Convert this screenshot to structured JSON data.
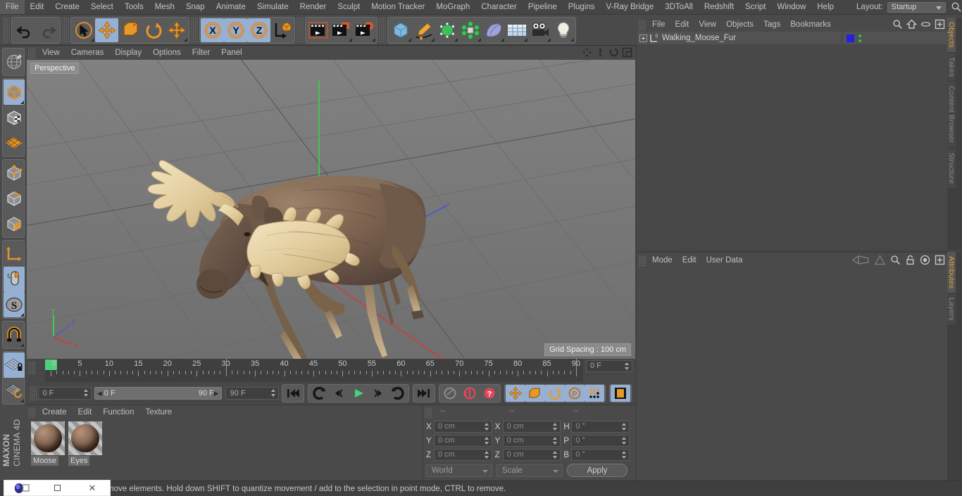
{
  "menubar": {
    "items": [
      "File",
      "Edit",
      "Create",
      "Select",
      "Tools",
      "Mesh",
      "Snap",
      "Animate",
      "Simulate",
      "Render",
      "Sculpt",
      "Motion Tracker",
      "MoGraph",
      "Character",
      "Pipeline",
      "Plugins",
      "V-Ray Bridge",
      "3DToAll",
      "Redshift",
      "Script",
      "Window",
      "Help"
    ],
    "layout_label": "Layout:",
    "layout_value": "Startup",
    "search_icon": "search-icon"
  },
  "toolbar": {
    "groups": [
      {
        "name": "undo-redo",
        "buttons": [
          {
            "icon": "undo-icon",
            "label": "Undo",
            "selected": false
          },
          {
            "icon": "redo-icon",
            "label": "Redo",
            "selected": false
          }
        ]
      },
      {
        "name": "transform-tools",
        "buttons": [
          {
            "icon": "live-selection-icon",
            "label": "Live Selection",
            "selected": false
          },
          {
            "icon": "move-icon",
            "label": "Move",
            "selected": true
          },
          {
            "icon": "scale-icon",
            "label": "Scale",
            "selected": false
          },
          {
            "icon": "rotate-icon",
            "label": "Rotate",
            "selected": false
          },
          {
            "icon": "move-alt-icon",
            "label": "Move Alt",
            "selected": false
          }
        ]
      },
      {
        "name": "axis-locks",
        "buttons": [
          {
            "icon": "axis-x-icon",
            "label": "X",
            "selected": true
          },
          {
            "icon": "axis-y-icon",
            "label": "Y",
            "selected": true
          },
          {
            "icon": "axis-z-icon",
            "label": "Z",
            "selected": true
          },
          {
            "icon": "world-object-axis-icon",
            "label": "World/Object",
            "selected": false
          }
        ]
      },
      {
        "name": "render-tools",
        "buttons": [
          {
            "icon": "render-view-icon",
            "label": "Render View",
            "selected": false
          },
          {
            "icon": "render-region-icon",
            "label": "Render to Picture Viewer",
            "selected": false
          },
          {
            "icon": "render-settings-icon",
            "label": "Edit Render Settings",
            "selected": false
          }
        ]
      },
      {
        "name": "create-tools",
        "buttons": [
          {
            "icon": "cube-icon",
            "label": "Add Cube Object",
            "selected": false
          },
          {
            "icon": "pen-spline-icon",
            "label": "Add Spline",
            "selected": false
          },
          {
            "icon": "generator-icon",
            "label": "Add Generator",
            "selected": false
          },
          {
            "icon": "deformer-icon",
            "label": "Add Deformer",
            "selected": false
          },
          {
            "icon": "environment-icon",
            "label": "Add Scene Object",
            "selected": false
          },
          {
            "icon": "floor-icon",
            "label": "Add Floor",
            "selected": false
          },
          {
            "icon": "camera-icon",
            "label": "Add Camera",
            "selected": false
          },
          {
            "icon": "light-icon",
            "label": "Add Light",
            "selected": false
          }
        ]
      }
    ]
  },
  "left_palette": {
    "groups": [
      {
        "buttons": [
          {
            "icon": "make-editable-icon",
            "label": "Make Editable",
            "selected": false
          }
        ]
      },
      {
        "buttons": [
          {
            "icon": "model-mode-icon",
            "label": "Model Mode",
            "selected": true
          },
          {
            "icon": "texture-mode-icon",
            "label": "Texture Mode",
            "selected": false
          },
          {
            "icon": "workplane-mode-icon",
            "label": "Workplane Mode",
            "selected": false
          }
        ]
      },
      {
        "buttons": [
          {
            "icon": "points-mode-icon",
            "label": "Points",
            "selected": false
          },
          {
            "icon": "edges-mode-icon",
            "label": "Edges",
            "selected": false
          },
          {
            "icon": "polygons-mode-icon",
            "label": "Polygons",
            "selected": false
          }
        ]
      },
      {
        "buttons": [
          {
            "icon": "object-axis-icon",
            "label": "Enable Axis Modification",
            "selected": false
          },
          {
            "icon": "viewport-solo-icon",
            "label": "Enable Viewport Solo",
            "selected": true
          },
          {
            "icon": "soft-selection-icon",
            "label": "Soft Selection",
            "selected": true
          }
        ]
      },
      {
        "buttons": [
          {
            "icon": "magnet-icon",
            "label": "Magnet",
            "selected": false
          }
        ]
      },
      {
        "buttons": [
          {
            "icon": "workplane-lock-icon",
            "label": "Lock Workplane",
            "selected": true
          },
          {
            "icon": "planar-workplane-icon",
            "label": "Planar Workplane",
            "selected": false
          }
        ]
      }
    ],
    "brand_top": "MAXON",
    "brand_bottom": "CINEMA 4D"
  },
  "viewport": {
    "menu": [
      "View",
      "Cameras",
      "Display",
      "Options",
      "Filter",
      "Panel"
    ],
    "corner_icons": [
      "pan-icon",
      "zoom-icon",
      "rotate-icon",
      "maximize-icon"
    ],
    "label": "Perspective",
    "grid_spacing": "Grid Spacing : 100 cm",
    "axis_labels": {
      "x": "X",
      "y": "Y",
      "z": "Z"
    },
    "axis_colors": {
      "x": "#d13b3b",
      "y": "#3fcf4a",
      "z": "#4a55d6"
    }
  },
  "timeline": {
    "ticks": [
      0,
      5,
      10,
      15,
      20,
      25,
      30,
      35,
      40,
      45,
      50,
      55,
      60,
      65,
      70,
      75,
      80,
      85,
      90
    ],
    "current_frame_field": "0 F"
  },
  "transport": {
    "current_frame": "0 F",
    "range_start": "0 F",
    "range_end": "90 F",
    "end_frame": "90 F",
    "buttons": [
      {
        "icon": "go-to-start-icon",
        "label": "Go to Start",
        "selected": false
      },
      {
        "icon": "step-back-key-icon",
        "label": "Go to Previous Key",
        "selected": false
      },
      {
        "icon": "step-back-frame-icon",
        "label": "Go to Previous Frame",
        "selected": false
      },
      {
        "icon": "play-icon",
        "label": "Play",
        "selected": false
      },
      {
        "icon": "step-forward-frame-icon",
        "label": "Go to Next Frame",
        "selected": false
      },
      {
        "icon": "step-forward-key-icon",
        "label": "Go to Next Key",
        "selected": false
      },
      {
        "icon": "go-to-end-icon",
        "label": "Go to End",
        "selected": false
      },
      {
        "icon": "record-active-objects-icon",
        "label": "Record Active Objects",
        "selected": false
      },
      {
        "icon": "autokeying-icon",
        "label": "Autokeying",
        "selected": false
      },
      {
        "icon": "keyframe-selection-icon",
        "label": "Keyframe Selection",
        "selected": false
      },
      {
        "icon": "position-key-icon",
        "label": "Position",
        "selected": true
      },
      {
        "icon": "scale-key-icon",
        "label": "Scale",
        "selected": true
      },
      {
        "icon": "rotation-key-icon",
        "label": "Rotation",
        "selected": true
      },
      {
        "icon": "param-key-icon",
        "label": "Parameter",
        "selected": true
      },
      {
        "icon": "pla-key-icon",
        "label": "Point Level Animation",
        "selected": true
      },
      {
        "icon": "timeline-icon",
        "label": "Timeline",
        "selected": true
      }
    ]
  },
  "material_manager": {
    "menu": [
      "Create",
      "Edit",
      "Function",
      "Texture"
    ],
    "materials": [
      {
        "name": "Moose",
        "icon": "material-sphere-icon"
      },
      {
        "name": "Eyes",
        "icon": "material-sphere-icon"
      }
    ]
  },
  "coordinates": {
    "headers": [
      "--",
      "--",
      "--"
    ],
    "rows": [
      {
        "l1": "X",
        "v1": "0 cm",
        "l2": "X",
        "v2": "0 cm",
        "l3": "H",
        "v3": "0 °"
      },
      {
        "l1": "Y",
        "v1": "0 cm",
        "l2": "Y",
        "v2": "0 cm",
        "l3": "P",
        "v3": "0 °"
      },
      {
        "l1": "Z",
        "v1": "0 cm",
        "l2": "Z",
        "v2": "0 cm",
        "l3": "B",
        "v3": "0 °"
      }
    ],
    "system": "World",
    "mode": "Scale",
    "apply": "Apply"
  },
  "object_manager": {
    "menu": [
      "File",
      "Edit",
      "View",
      "Objects",
      "Tags",
      "Bookmarks"
    ],
    "icons": [
      "search-icon",
      "home-icon",
      "ellipse-icon",
      "add-layer-icon"
    ],
    "rows": [
      {
        "name": "Walking_Moose_Fur",
        "layer_color": "#2222dd",
        "level": "0"
      }
    ]
  },
  "attribute_manager": {
    "menu": [
      "Mode",
      "Edit",
      "User Data"
    ],
    "icons": [
      "nav-back-icon",
      "nav-forward-icon",
      "search-icon",
      "lock-icon",
      "target-icon",
      "add-icon"
    ]
  },
  "right_tabs_upper": [
    {
      "label": "Objects",
      "active": true
    },
    {
      "label": "Takes",
      "active": false
    },
    {
      "label": "Content Browser",
      "active": false
    },
    {
      "label": "Structure",
      "active": false
    }
  ],
  "right_tabs_lower": [
    {
      "label": "Attributes",
      "active": true
    },
    {
      "label": "Layers",
      "active": false
    }
  ],
  "statusbar": {
    "text": "move elements. Hold down SHIFT to quantize movement / add to the selection in point mode, CTRL to remove."
  },
  "window_buttons": {
    "logo_icon": "app-logo-icon",
    "restore_icon": "restore-window-icon",
    "close_icon": "close-window-icon"
  },
  "colors": {
    "accent_orange": "#e2a23a",
    "selection_blue": "#96b0d4",
    "panel_bg": "#4a4a4a",
    "viewport_bg": "#777777"
  }
}
